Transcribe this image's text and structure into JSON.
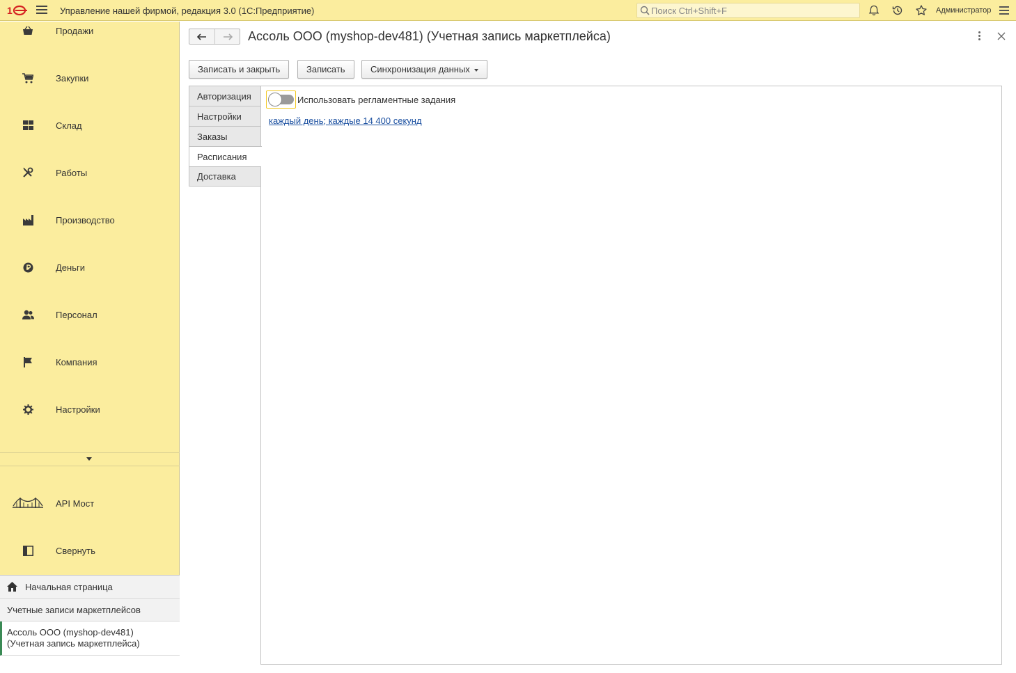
{
  "app": {
    "title": "Управление нашей фирмой, редакция 3.0  (1С:Предприятие)",
    "search_placeholder": "Поиск Ctrl+Shift+F",
    "user": "Администратор"
  },
  "sidebar": {
    "items": [
      {
        "label": "Продажи",
        "icon": "basket-icon"
      },
      {
        "label": "Закупки",
        "icon": "cart-icon"
      },
      {
        "label": "Склад",
        "icon": "warehouse-icon"
      },
      {
        "label": "Работы",
        "icon": "tools-icon"
      },
      {
        "label": "Производство",
        "icon": "factory-icon"
      },
      {
        "label": "Деньги",
        "icon": "ruble-icon"
      },
      {
        "label": "Персонал",
        "icon": "people-icon"
      },
      {
        "label": "Компания",
        "icon": "flag-icon"
      },
      {
        "label": "Настройки",
        "icon": "gear-icon"
      }
    ],
    "extra_items": [
      {
        "label": "API Мост",
        "icon": "bridge-icon"
      },
      {
        "label": "Свернуть",
        "icon": "collapse-panel-icon"
      }
    ],
    "open_windows": {
      "home": "Начальная страница",
      "list": "Учетные записи маркетплейсов",
      "current": "Ассоль ООО (myshop-dev481) (Учетная запись маркетплейса)"
    }
  },
  "form": {
    "title": "Ассоль ООО (myshop-dev481) (Учетная запись маркетплейса)",
    "buttons": {
      "save_close": "Записать и закрыть",
      "save": "Записать",
      "sync": "Синхронизация данных"
    },
    "tabs": [
      {
        "label": "Авторизация",
        "active": false
      },
      {
        "label": "Настройки",
        "active": false
      },
      {
        "label": "Заказы",
        "active": false
      },
      {
        "label": "Расписания",
        "active": true
      },
      {
        "label": "Доставка",
        "active": false
      }
    ],
    "schedule": {
      "toggle_label": "Использовать регламентные задания",
      "toggle_on": false,
      "schedule_link": "каждый день; каждые 14 400 секунд"
    }
  },
  "colors": {
    "panel_bg": "#fbed9e",
    "link": "#1a4fa0",
    "focus": "#f2c924",
    "current_marker": "#3a8a55"
  }
}
